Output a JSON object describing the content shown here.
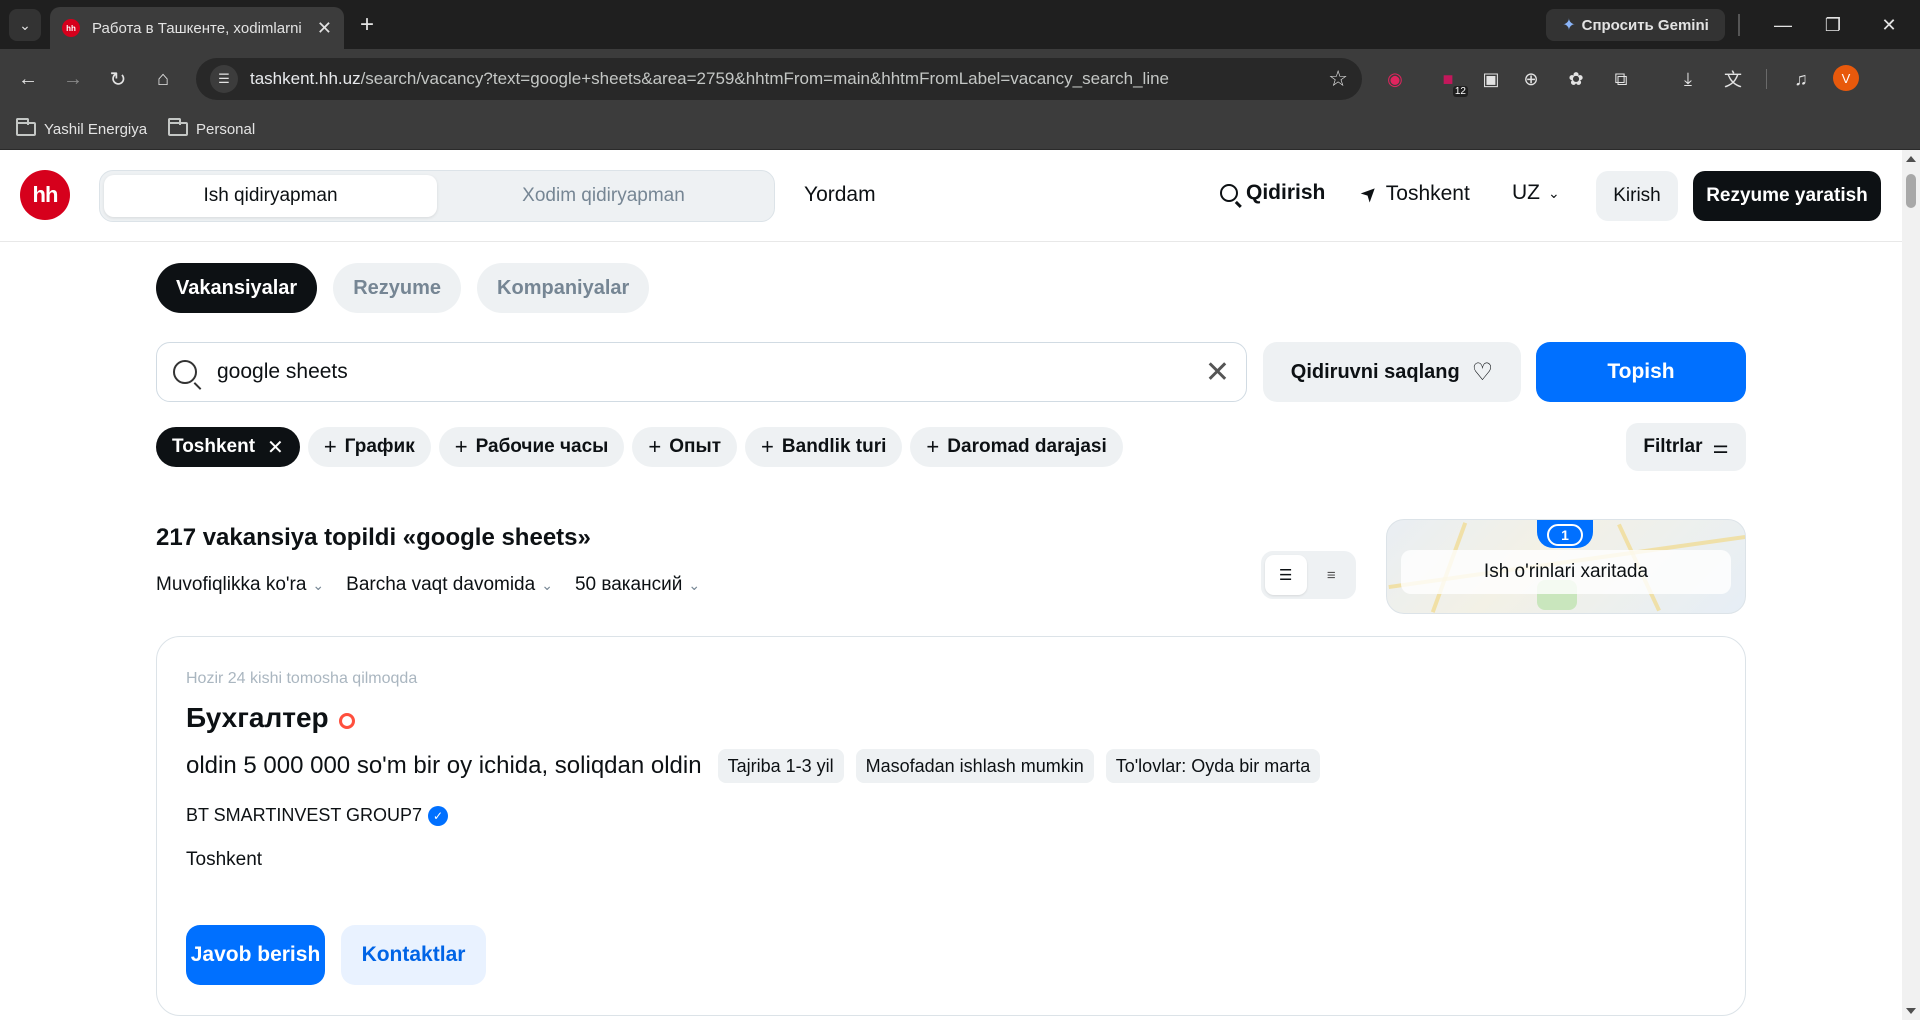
{
  "browser": {
    "tab_title": "Работа в Ташкенте, xodimlarni",
    "gemini_label": "Спросить Gemini",
    "url_host": "tashkent.hh.uz",
    "url_path": "/search/vacancy?text=google+sheets&area=2759&hhtmFrom=main&hhtmFromLabel=vacancy_search_line",
    "ext_badge": "12",
    "profile_initial": "V",
    "bookmarks": [
      "Yashil Energiya",
      "Personal"
    ]
  },
  "header": {
    "logo": "hh",
    "role_tabs": [
      "Ish qidiryapman",
      "Xodim qidiryapman"
    ],
    "help": "Yordam",
    "search": "Qidirish",
    "city": "Toshkent",
    "lang": "UZ",
    "login": "Kirish",
    "create_resume": "Rezyume yaratish"
  },
  "sections": [
    "Vakansiyalar",
    "Rezyume",
    "Kompaniyalar"
  ],
  "search": {
    "query": "google sheets",
    "save_label": "Qidiruvni saqlang",
    "submit": "Topish"
  },
  "filters": {
    "active": "Toshkent",
    "chips": [
      "График",
      "Рабочие часы",
      "Опыт",
      "Bandlik turi",
      "Daromad darajasi"
    ],
    "more": "Filtrlar"
  },
  "results": {
    "title": "217 vakansiya topildi «google sheets»",
    "sort": [
      "Muvofiqlikka ko'ra",
      "Barcha vaqt davomida",
      "50 вакансий"
    ],
    "map_label": "Ish o'rinlari xaritada",
    "map_count": "1"
  },
  "vacancy": {
    "viewers": "Hozir 24 kishi tomosha qilmoqda",
    "title": "Бухгалтер",
    "salary": "oldin 5 000 000 so'm bir oy ichida, soliqdan oldin",
    "tags": [
      "Tajriba 1-3 yil",
      "Masofadan ishlash mumkin",
      "To'lovlar: Oyda bir marta"
    ],
    "company": "BT SMARTINVEST GROUP7",
    "city": "Toshkent",
    "apply": "Javob berish",
    "contacts": "Kontaktlar"
  },
  "colors": {
    "brand": "#d6001c",
    "primary": "#0070ff",
    "dark": "#0d1114",
    "chip_bg": "#eef1f3"
  },
  "icons": [
    "search-icon",
    "location-arrow-icon",
    "chevron-down-icon",
    "close-icon",
    "heart-search-icon",
    "filter-sliders-icon",
    "list-view-icon",
    "compact-list-icon",
    "flame-icon",
    "verified-badge-icon"
  ]
}
